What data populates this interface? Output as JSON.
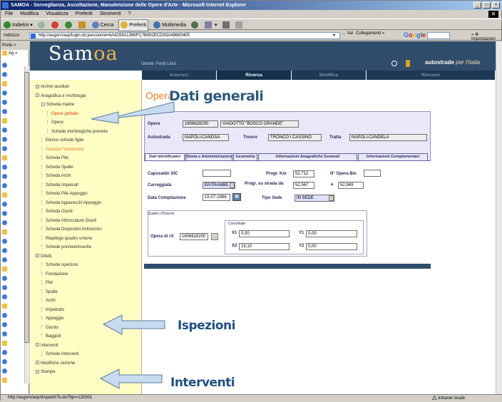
{
  "window": {
    "title": "SAMOA - Sorveglianza, Ascoltazione, Manutenzione delle Opere d'Arte - Microsoft Internet Explorer",
    "buttons": [
      "_",
      "□",
      "×"
    ]
  },
  "menubar": [
    "File",
    "Modifica",
    "Visualizza",
    "Preferiti",
    "Strumenti",
    "?"
  ],
  "toolbar": {
    "back": "Indietro",
    "search": "Cerca",
    "favorites": "Preferiti",
    "multimedia": "Multimedia"
  },
  "address": {
    "label": "Indirizzo",
    "url": "http://asgorv/asp/login.do;jsessionid=6A4293A1396FC7B892ECD93A49680405",
    "go": "Vai",
    "links": "Collegamenti",
    "google": "Google",
    "settings": "Impostazioni"
  },
  "favorites": {
    "header": "Prefe ×",
    "search_label": "Ag"
  },
  "app": {
    "logo_main": "Sam",
    "logo_accent": "oa",
    "user": "Utente: Ferdi Livia",
    "brand": "autostrade",
    "brand_tag": "per l'Italia"
  },
  "nav_tabs": [
    {
      "label": "Inserisci",
      "active": false
    },
    {
      "label": "Ricerca",
      "active": true
    },
    {
      "label": "Modifica",
      "active": false
    },
    {
      "label": "Rimuovi",
      "active": false
    }
  ],
  "tree": [
    {
      "label": "Archivi ausiliari",
      "indent": 0,
      "type": "root"
    },
    {
      "label": "Anagrafica e morfologia",
      "indent": 0,
      "type": "root"
    },
    {
      "label": "Scheda madre",
      "indent": 1,
      "type": "node"
    },
    {
      "label": "Opere globale",
      "indent": 2,
      "type": "red"
    },
    {
      "label": "Opera",
      "indent": 2,
      "type": "leaf"
    },
    {
      "label": "Schede morfologiche previste",
      "indent": 2,
      "type": "leaf"
    },
    {
      "label": "Elenco schede figlie",
      "indent": 1,
      "type": "leaf"
    },
    {
      "label": "Scheda Fondazione",
      "indent": 1,
      "type": "orange"
    },
    {
      "label": "Scheda Pile",
      "indent": 1,
      "type": "leaf"
    },
    {
      "label": "Scheda Spalle",
      "indent": 1,
      "type": "leaf"
    },
    {
      "label": "Scheda Archi",
      "indent": 1,
      "type": "leaf"
    },
    {
      "label": "Scheda Impalcati",
      "indent": 1,
      "type": "leaf"
    },
    {
      "label": "Scheda Pile Appoggio",
      "indent": 1,
      "type": "leaf"
    },
    {
      "label": "Scheda Apparecchi Appoggio",
      "indent": 1,
      "type": "leaf"
    },
    {
      "label": "Scheda Giunti",
      "indent": 1,
      "type": "leaf"
    },
    {
      "label": "Scheda Attrezzature Giunti",
      "indent": 1,
      "type": "leaf"
    },
    {
      "label": "Scheda Dispositivi Antisismici",
      "indent": 1,
      "type": "leaf"
    },
    {
      "label": "Riepilogo quadro unione",
      "indent": 1,
      "type": "leaf"
    },
    {
      "label": "Schede previste/inserite",
      "indent": 1,
      "type": "leaf"
    },
    {
      "label": "Difetti",
      "indent": 0,
      "type": "root"
    },
    {
      "label": "Schede ispezioni",
      "indent": 1,
      "type": "leaf"
    },
    {
      "label": "Fondazione",
      "indent": 1,
      "type": "leaf"
    },
    {
      "label": "Pile",
      "indent": 1,
      "type": "leaf"
    },
    {
      "label": "Spalle",
      "indent": 1,
      "type": "leaf"
    },
    {
      "label": "Archi",
      "indent": 1,
      "type": "leaf"
    },
    {
      "label": "Impalcato",
      "indent": 1,
      "type": "leaf"
    },
    {
      "label": "Appoggio",
      "indent": 1,
      "type": "leaf"
    },
    {
      "label": "Giunto",
      "indent": 1,
      "type": "leaf"
    },
    {
      "label": "Baggioli",
      "indent": 1,
      "type": "leaf"
    },
    {
      "label": "Interventi",
      "indent": 0,
      "type": "root"
    },
    {
      "label": "Schede interventi",
      "indent": 1,
      "type": "leaf"
    },
    {
      "label": "Modifiche storiche",
      "indent": 0,
      "type": "root"
    },
    {
      "label": "Stampe",
      "indent": 0,
      "type": "root"
    }
  ],
  "form": {
    "opera_word": "Opera",
    "title": "Dati generali",
    "opera_label": "Opera",
    "opera_code": "1606628200",
    "opera_name": "VIADOTTO \"BOSCO GRANDE\"",
    "autostrada_label": "Autostrada",
    "autostrada_value": "NAPOLI-CANOSA",
    "tronco_label": "Tronco",
    "tronco_value": "TRONCO I CASSINO",
    "tratta_label": "Tratta",
    "tratta_value": "NAPOLI-CANDELA",
    "tabs": [
      "Dati Identificativi",
      "Storia e Amministrazione",
      "Geometria",
      "Informazioni Anagrafiche Generali",
      "Informazioni Complementari"
    ],
    "caposaldo_label": "Caposaldo SIC",
    "caposaldo_value": "",
    "progr_km_label": "Progr. Km",
    "progr_km_value": "52,712",
    "opera_bis_label": "N° Opera Bis",
    "opera_bis_value": "",
    "carreggiata_label": "Carreggiata",
    "carreggiata_value": "ENTRAMBE",
    "progr_strada_label": "Progr. su strada da",
    "progr_strada_from": "52,567",
    "progr_strada_a": "a",
    "progr_strada_to": "52,949",
    "data_comp_label": "Data Compilazione",
    "data_comp_value": "15-07-1996",
    "tipo_sede_label": "Tipo Sede",
    "tipo_sede_value": "IN SEDE",
    "quadro_label": "Quadro d'Unione",
    "opera_rif_label": "Opera di rif.",
    "opera_rif_value": "1606628200",
    "coord_label": "Coordinate",
    "x1_label": "X1",
    "x1_value": "0,00",
    "y1_label": "Y1",
    "y1_value": "0,00",
    "x2_label": "X2",
    "x2_value": "19,10",
    "y2_label": "Y2",
    "y2_value": "0,00"
  },
  "annotations": {
    "ispezioni": "Ispezioni",
    "interventi": "Interventi"
  },
  "status": {
    "url": "http://asgorv/asp/dispatchTo.do?fqn=120301",
    "zone": "Intranet locale"
  }
}
